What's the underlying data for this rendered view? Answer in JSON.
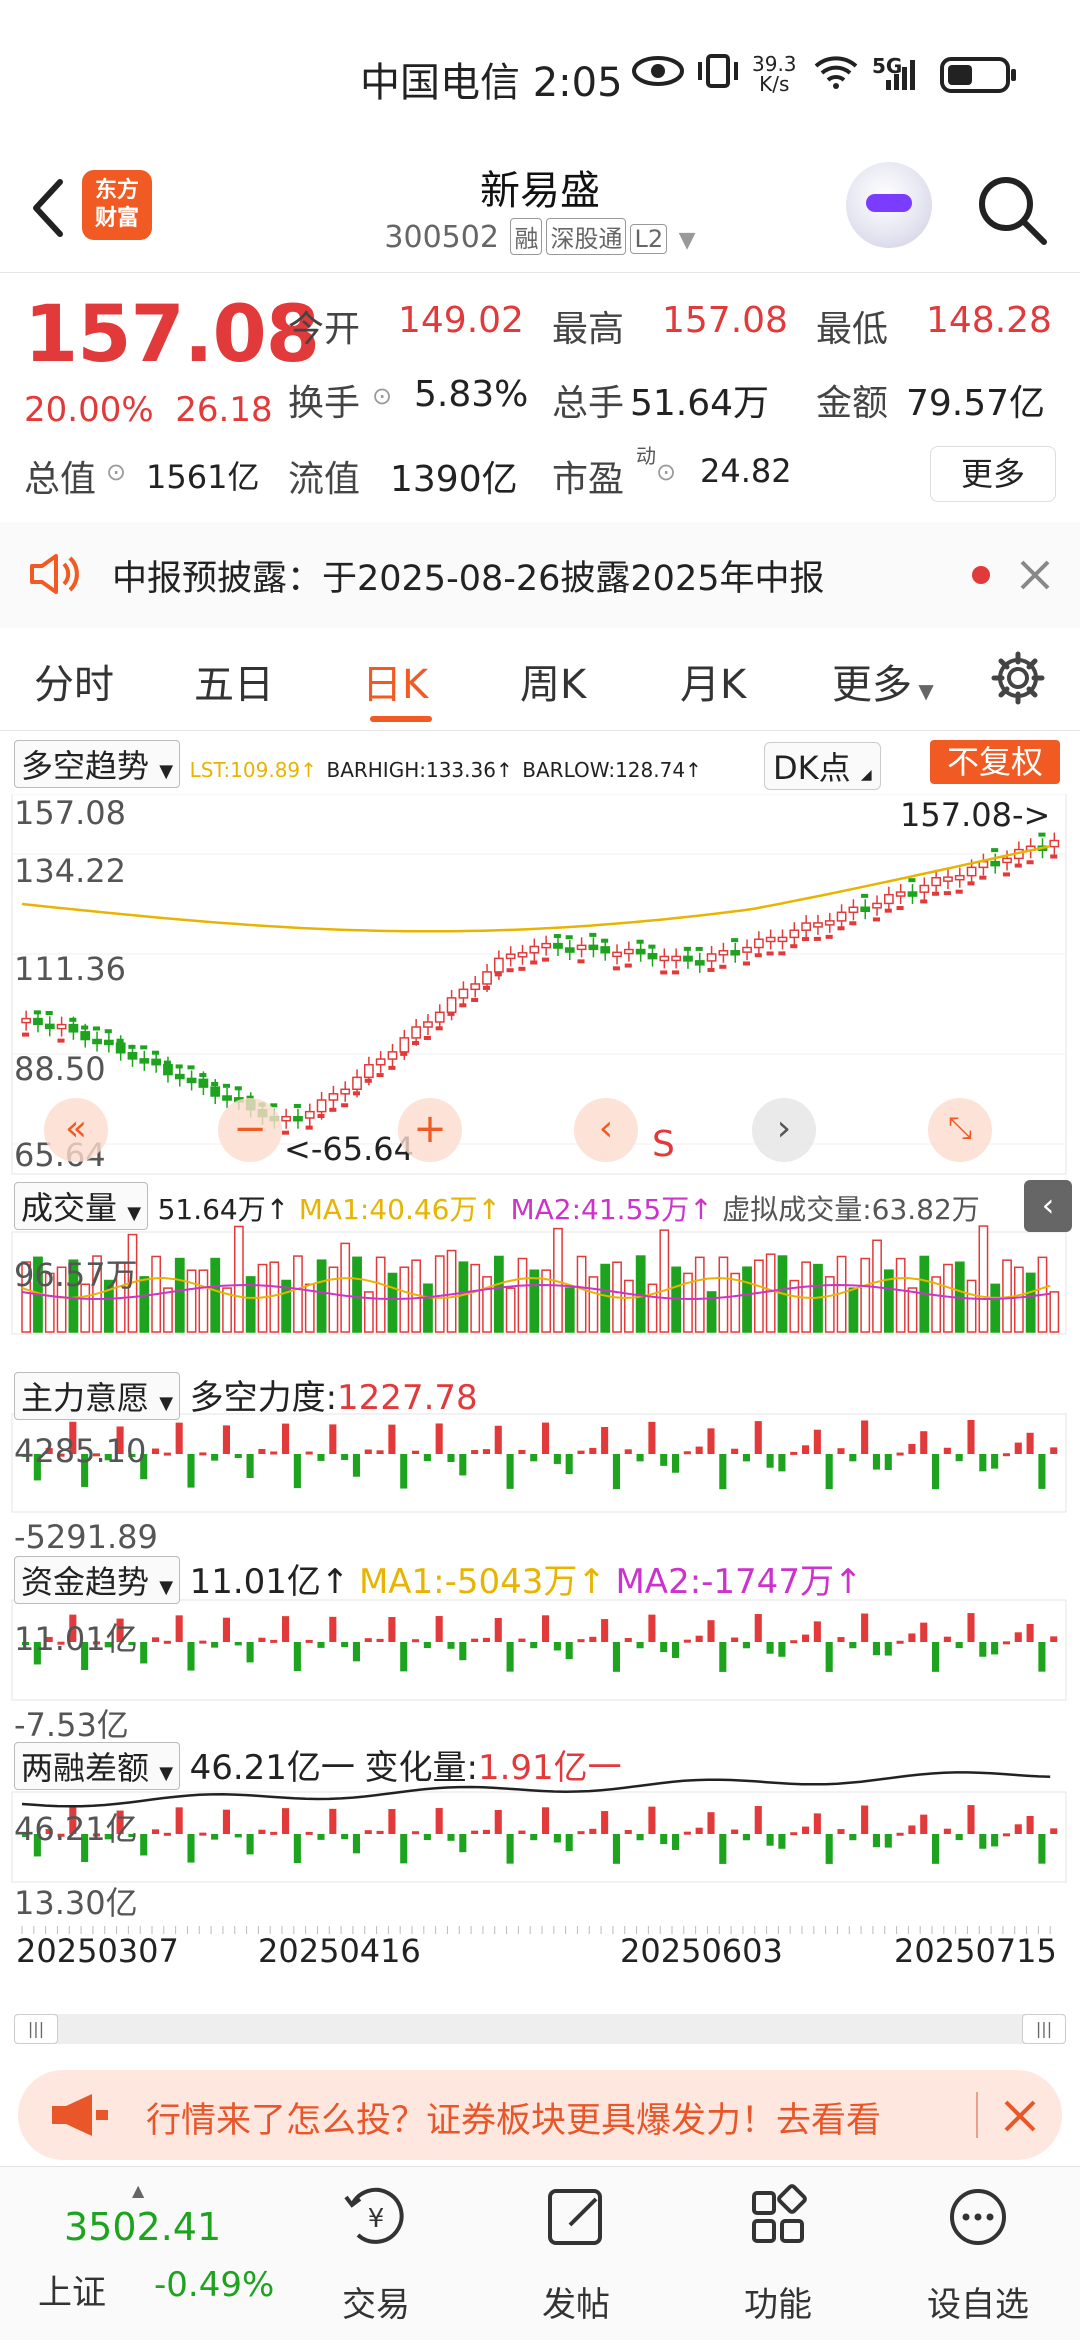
{
  "status_bar": {
    "carrier": "中国电信",
    "time": "2:05",
    "net_speed_value": "39.3",
    "net_speed_unit": "K/s",
    "net_type": "5G"
  },
  "header": {
    "back_icon": "back-arrow-icon",
    "logo_line1": "东方",
    "logo_line2": "财富",
    "stock_name": "新易盛",
    "stock_code": "300502",
    "tags": [
      "融",
      "深股通",
      "L2"
    ]
  },
  "quote": {
    "price": "157.08",
    "change_pct": "20.00%",
    "change_amt": "26.18",
    "open_label": "今开",
    "open": "149.02",
    "high_label": "最高",
    "high": "157.08",
    "low_label": "最低",
    "low": "148.28",
    "turnover_label": "换手",
    "turnover": "5.83%",
    "volume_label": "总手",
    "volume": "51.64万",
    "amount_label": "金额",
    "amount": "79.57亿",
    "mktcap_label": "总值",
    "mktcap": "1561亿",
    "float_label": "流值",
    "float_cap": "1390亿",
    "pe_label": "市盈",
    "pe_sup": "动",
    "pe": "24.82",
    "more_label": "更多"
  },
  "notice": {
    "text": "中报预披露：于2025-08-26披露2025年中报"
  },
  "tabs": [
    "分时",
    "五日",
    "日K",
    "周K",
    "月K",
    "更多"
  ],
  "active_tab": "日K",
  "kline": {
    "indicator": "多空趋势",
    "lst": "LST:109.89↑",
    "barhigh": "BARHIGH:133.36↑",
    "barlow": "BARLOW:128.74↑",
    "dk_label": "DK点",
    "adj_label": "不复权",
    "y_labels": [
      "157.08",
      "134.22",
      "111.36",
      "88.50",
      "65.64"
    ],
    "last_marker": "157.08->",
    "low_marker": "<-65.64",
    "s_marker": "S"
  },
  "volume_panel": {
    "indicator": "成交量",
    "value": "51.64万↑",
    "ma1": "MA1:40.46万↑",
    "ma2": "MA2:41.55万↑",
    "virtual": "虚拟成交量:63.82万",
    "y_max": "96.57万"
  },
  "main_force_panel": {
    "indicator": "主力意愿",
    "label": "多空力度:",
    "value": "1227.78",
    "y_max": "4285.10",
    "y_min": "-5291.89"
  },
  "fund_trend_panel": {
    "indicator": "资金趋势",
    "value": "11.01亿↑",
    "ma1": "MA1:-5043万↑",
    "ma2": "MA2:-1747万↑",
    "y_max": "11.01亿",
    "y_min": "-7.53亿"
  },
  "margin_panel": {
    "indicator": "两融差额",
    "value": "46.21亿一",
    "change_label": "变化量:",
    "change": "1.91亿一",
    "y_max": "46.21亿",
    "y_min": "13.30亿"
  },
  "dates": [
    "20250307",
    "20250416",
    "20250603",
    "20250715"
  ],
  "banner": {
    "text": "行情来了怎么投？证券板块更具爆发力！去看看"
  },
  "bottom": {
    "index_value": "3502.41",
    "index_name": "上证",
    "index_change": "-0.49%",
    "items": [
      "交易",
      "发帖",
      "功能",
      "设自选"
    ]
  },
  "colors": {
    "up": "#e23a3a",
    "down": "#1ea31e",
    "accent": "#f15a22",
    "ma1": "#e8b400",
    "ma2": "#cc33cc"
  }
}
